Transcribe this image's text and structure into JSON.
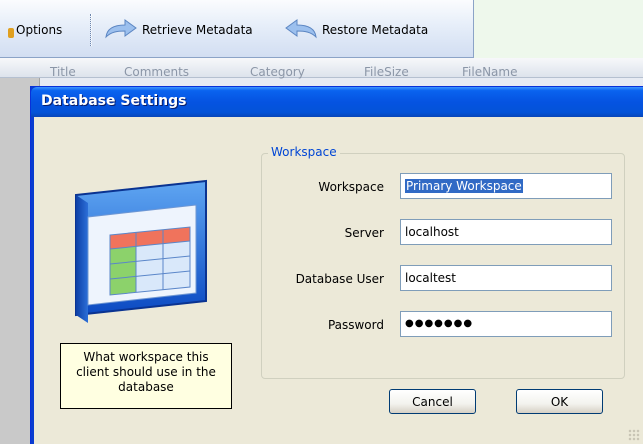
{
  "toolbar": {
    "options_label": "Options",
    "retrieve_label": "Retrieve Metadata",
    "restore_label": "Restore Metadata"
  },
  "grid": {
    "columns": [
      "Title",
      "Comments",
      "Category",
      "FileSize",
      "FileName"
    ]
  },
  "dialog": {
    "title": "Database Settings",
    "group_title": "Workspace",
    "fields": {
      "workspace": {
        "label": "Workspace",
        "value": "Primary Workspace"
      },
      "server": {
        "label": "Server",
        "value": "localhost"
      },
      "db_user": {
        "label": "Database User",
        "value": "localtest"
      },
      "password": {
        "label": "Password",
        "value": "●●●●●●●"
      }
    },
    "tooltip": "What workspace this client should use in the database",
    "cancel_label": "Cancel",
    "ok_label": "OK"
  },
  "icons": {
    "database": "database-table-icon",
    "retrieve": "arrow-forward-icon",
    "restore": "arrow-back-icon"
  },
  "colors": {
    "titlebar": "#0553e1",
    "dialog_bg": "#ece9d8",
    "group_title": "#0046d5",
    "selection": "#316ac5",
    "tooltip_bg": "#ffffe1"
  }
}
